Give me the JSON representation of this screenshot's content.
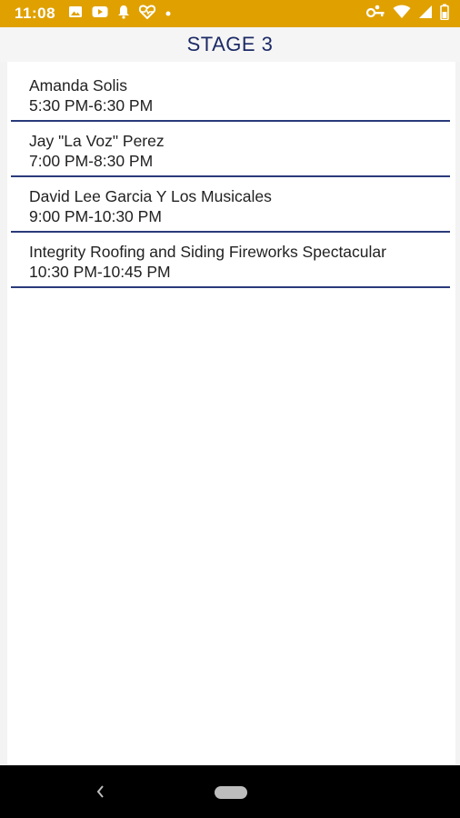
{
  "status_bar": {
    "time": "11:08",
    "icons_left": [
      "image-icon",
      "youtube-icon",
      "notification-bell-icon",
      "heart-monitor-icon",
      "dot-icon"
    ],
    "icons_right": [
      "vpn-key-icon",
      "wifi-icon",
      "signal-icon",
      "battery-icon"
    ],
    "color": "#e0a100"
  },
  "header": {
    "title": "STAGE 3"
  },
  "schedule": [
    {
      "performer": "Amanda Solis",
      "time": "5:30 PM-6:30 PM"
    },
    {
      "performer": "Jay \"La Voz\" Perez",
      "time": "7:00 PM-8:30 PM"
    },
    {
      "performer": "David Lee Garcia Y Los Musicales",
      "time": "9:00 PM-10:30 PM"
    },
    {
      "performer": "Integrity Roofing and Siding Fireworks Spectacular",
      "time": "10:30 PM-10:45 PM"
    }
  ],
  "colors": {
    "accent": "#1c2a66",
    "divider": "#2a3a7a"
  }
}
